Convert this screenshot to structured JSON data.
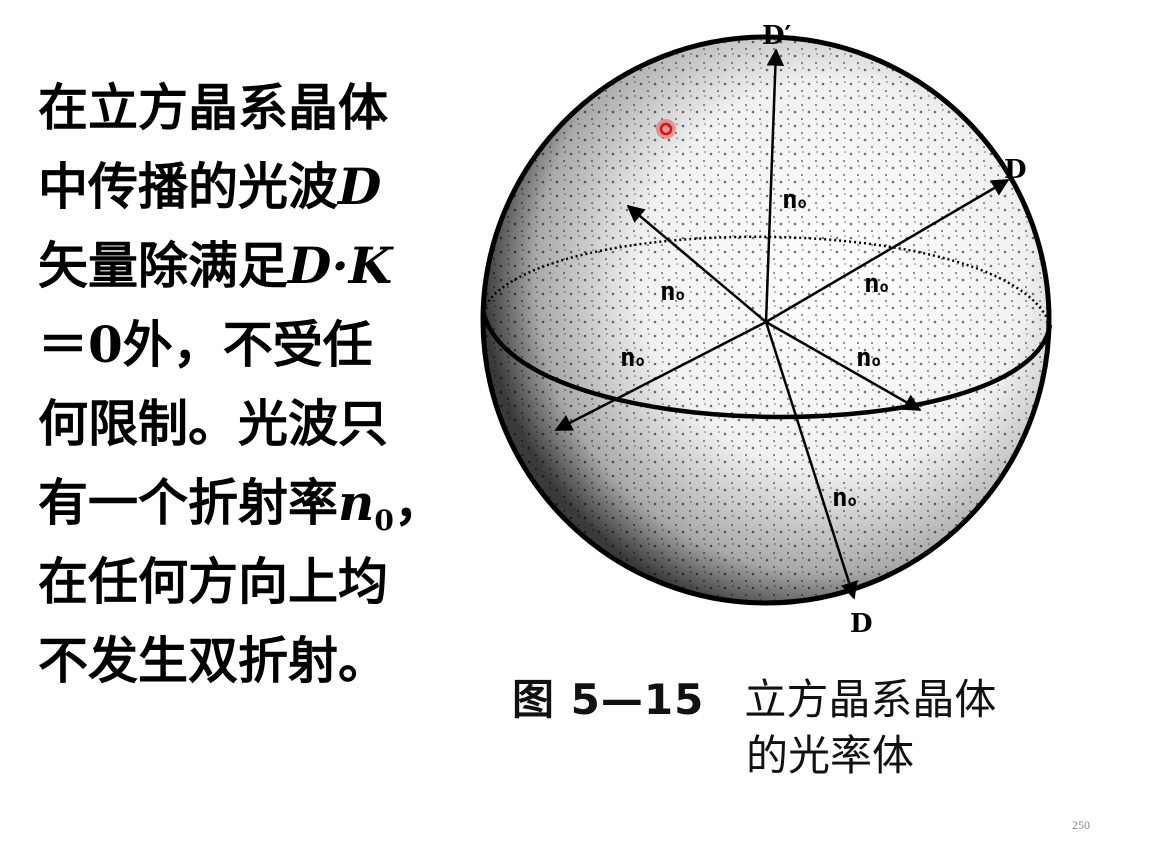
{
  "text": {
    "line1": "在立方晶系晶体",
    "line2_a": "中传播的光波",
    "line2_b": "D",
    "line3_a": "矢量除满足",
    "line3_b": "D·K",
    "line4": "＝0外，不受任",
    "line5": "何限制。光波只",
    "line6_a": "有一个折射率",
    "line6_b": "n",
    "line6_sub": "0",
    "line6_c": "，",
    "line7": "在任何方向上均",
    "line8": "不发生双折射。"
  },
  "figure": {
    "label_d_prime": "D′",
    "label_d_right": "D",
    "label_d_bottom": "D",
    "index_main": "n",
    "index_sub": "o",
    "caption_number": "图 5—15",
    "caption_title": "立方晶系晶体",
    "caption_title_line2": "的光率体"
  },
  "page_number": "250",
  "colors": {
    "pointer": "#e01010",
    "ink": "#000000",
    "page_number": "#888888"
  }
}
